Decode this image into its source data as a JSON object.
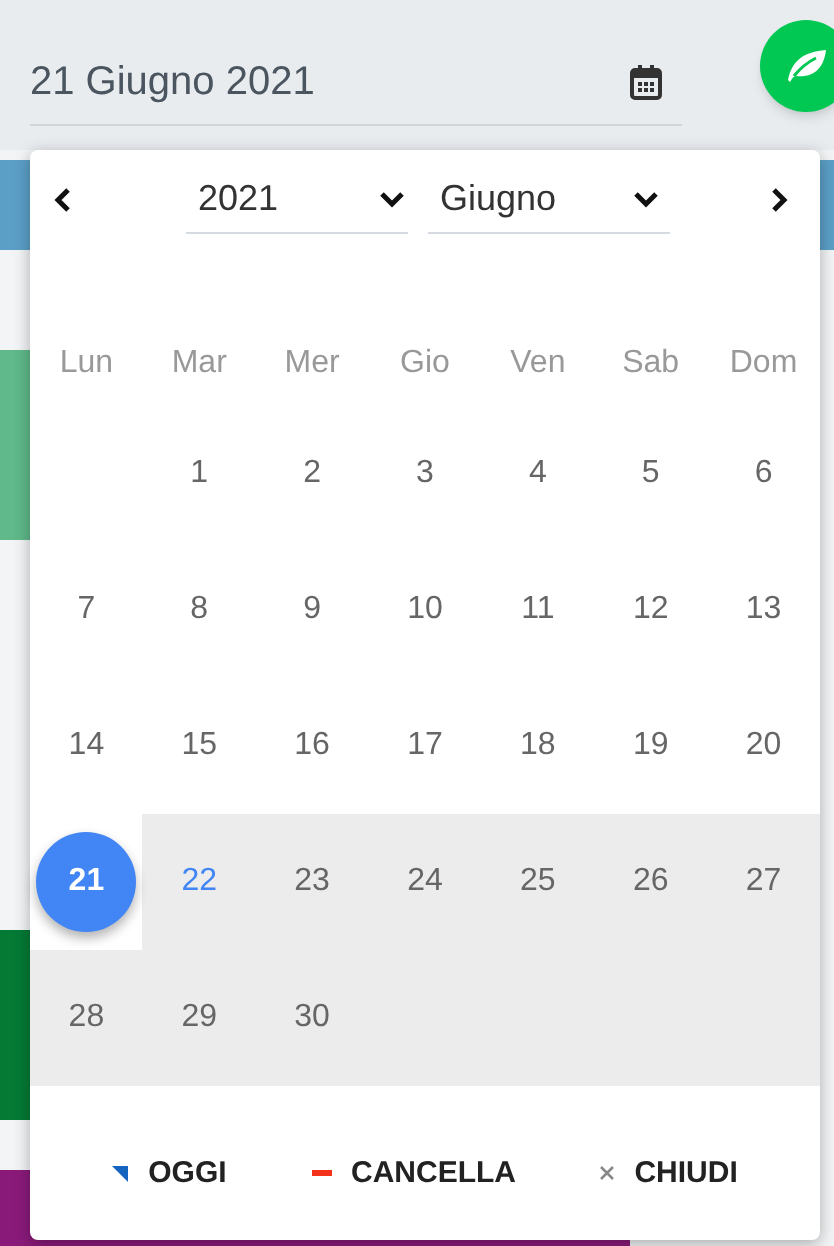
{
  "date_field": {
    "value": "21 Giugno 2021"
  },
  "picker": {
    "year": "2021",
    "month": "Giugno",
    "weekdays": [
      "Lun",
      "Mar",
      "Mer",
      "Gio",
      "Ven",
      "Sab",
      "Dom"
    ],
    "weeks": [
      {
        "highlighted": false,
        "days": [
          {
            "kind": "blank"
          },
          {
            "kind": "day",
            "day": "1",
            "selected": false,
            "today": false
          },
          {
            "kind": "day",
            "day": "2",
            "selected": false,
            "today": false
          },
          {
            "kind": "day",
            "day": "3",
            "selected": false,
            "today": false
          },
          {
            "kind": "day",
            "day": "4",
            "selected": false,
            "today": false
          },
          {
            "kind": "day",
            "day": "5",
            "selected": false,
            "today": false
          },
          {
            "kind": "day",
            "day": "6",
            "selected": false,
            "today": false
          }
        ]
      },
      {
        "highlighted": false,
        "days": [
          {
            "kind": "day",
            "day": "7",
            "selected": false,
            "today": false
          },
          {
            "kind": "day",
            "day": "8",
            "selected": false,
            "today": false
          },
          {
            "kind": "day",
            "day": "9",
            "selected": false,
            "today": false
          },
          {
            "kind": "day",
            "day": "10",
            "selected": false,
            "today": false
          },
          {
            "kind": "day",
            "day": "11",
            "selected": false,
            "today": false
          },
          {
            "kind": "day",
            "day": "12",
            "selected": false,
            "today": false
          },
          {
            "kind": "day",
            "day": "13",
            "selected": false,
            "today": false
          }
        ]
      },
      {
        "highlighted": false,
        "days": [
          {
            "kind": "day",
            "day": "14",
            "selected": false,
            "today": false
          },
          {
            "kind": "day",
            "day": "15",
            "selected": false,
            "today": false
          },
          {
            "kind": "day",
            "day": "16",
            "selected": false,
            "today": false
          },
          {
            "kind": "day",
            "day": "17",
            "selected": false,
            "today": false
          },
          {
            "kind": "day",
            "day": "18",
            "selected": false,
            "today": false
          },
          {
            "kind": "day",
            "day": "19",
            "selected": false,
            "today": false
          },
          {
            "kind": "day",
            "day": "20",
            "selected": false,
            "today": false
          }
        ]
      },
      {
        "highlighted": true,
        "days": [
          {
            "kind": "day",
            "day": "21",
            "selected": true,
            "today": false
          },
          {
            "kind": "day",
            "day": "22",
            "selected": false,
            "today": true
          },
          {
            "kind": "day",
            "day": "23",
            "selected": false,
            "today": false
          },
          {
            "kind": "day",
            "day": "24",
            "selected": false,
            "today": false
          },
          {
            "kind": "day",
            "day": "25",
            "selected": false,
            "today": false
          },
          {
            "kind": "day",
            "day": "26",
            "selected": false,
            "today": false
          },
          {
            "kind": "day",
            "day": "27",
            "selected": false,
            "today": false
          }
        ]
      },
      {
        "highlighted": true,
        "days": [
          {
            "kind": "day",
            "day": "28",
            "selected": false,
            "today": false
          },
          {
            "kind": "day",
            "day": "29",
            "selected": false,
            "today": false
          },
          {
            "kind": "day",
            "day": "30",
            "selected": false,
            "today": false
          },
          {
            "kind": "blank"
          },
          {
            "kind": "blank"
          },
          {
            "kind": "blank"
          },
          {
            "kind": "blank"
          }
        ]
      }
    ],
    "actions": [
      {
        "kind": "today",
        "label": "OGGI"
      },
      {
        "kind": "clear",
        "label": "CANCELLA"
      },
      {
        "kind": "close",
        "label": "CHIUDI"
      }
    ]
  }
}
